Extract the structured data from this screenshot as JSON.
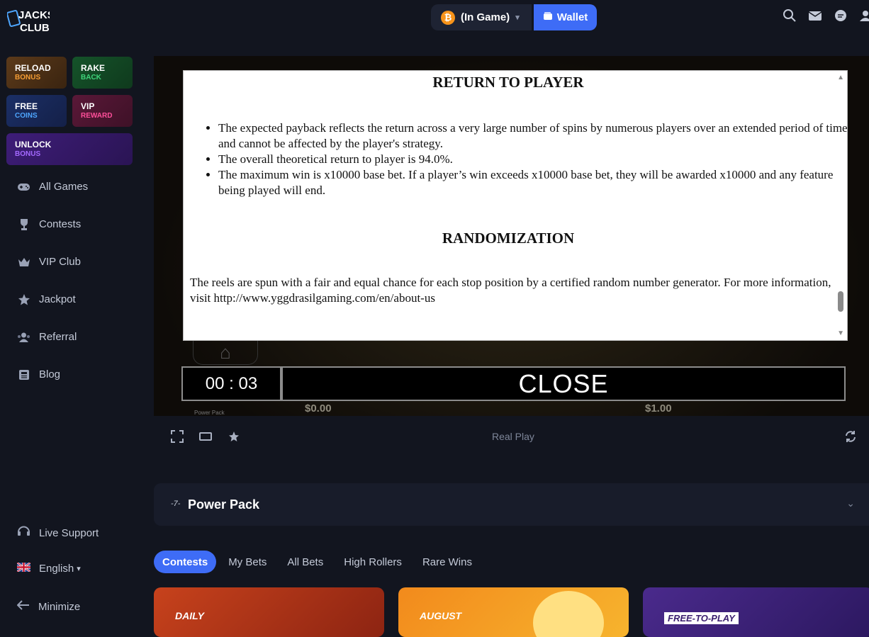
{
  "header": {
    "logo_text": "JACKS CLUB",
    "balance_label": "(In Game)",
    "wallet_label": "Wallet"
  },
  "promos": [
    {
      "line1": "RELOAD",
      "line2": "BONUS"
    },
    {
      "line1": "RAKE",
      "line2": "BACK"
    },
    {
      "line1": "FREE",
      "line2": "COINS"
    },
    {
      "line1": "VIP",
      "line2": "REWARD"
    },
    {
      "line1": "UNLOCK",
      "line2": "BONUS"
    }
  ],
  "nav": [
    {
      "label": "All Games",
      "icon": "gamepad-icon"
    },
    {
      "label": "Contests",
      "icon": "trophy-icon"
    },
    {
      "label": "VIP Club",
      "icon": "crown-icon"
    },
    {
      "label": "Jackpot",
      "icon": "star-icon"
    },
    {
      "label": "Referral",
      "icon": "users-icon"
    },
    {
      "label": "Blog",
      "icon": "newspaper-icon"
    }
  ],
  "bottom_nav": {
    "live_support": "Live Support",
    "language": "English",
    "minimize": "Minimize"
  },
  "dialog": {
    "rtp_heading": "RETURN TO PLAYER",
    "bullets": [
      "The expected payback reflects the return across a very large number of spins by numerous players over an extended period of time and cannot be affected by the player's strategy.",
      "The overall theoretical return to player is 94.0%.",
      "The maximum win is x10000 base bet. If a player’s win exceeds x10000 base bet, they will be awarded x10000 and any feature being played will end."
    ],
    "random_heading": "RANDOMIZATION",
    "random_text": "The reels are spun with a fair and equal chance for each stop position by a certified random number generator. For more information, visit http://www.yggdrasilgaming.com/en/about-us"
  },
  "game": {
    "timer": "00 : 03",
    "close_label": "CLOSE",
    "balance_value": "$0.00",
    "bet_value": "$1.00",
    "small_label": "Power Pack",
    "mode_label": "Real Play"
  },
  "game_panel": {
    "title": "Power Pack"
  },
  "tabs": [
    "Contests",
    "My Bets",
    "All Bets",
    "High Rollers",
    "Rare Wins"
  ],
  "cards": [
    {
      "title": "DAILY",
      "color": "#c7421c"
    },
    {
      "title": "AUGUST",
      "color": "#f28a1c"
    },
    {
      "title": "FREE-TO-PLAY",
      "color": "#4a2a8c"
    }
  ]
}
